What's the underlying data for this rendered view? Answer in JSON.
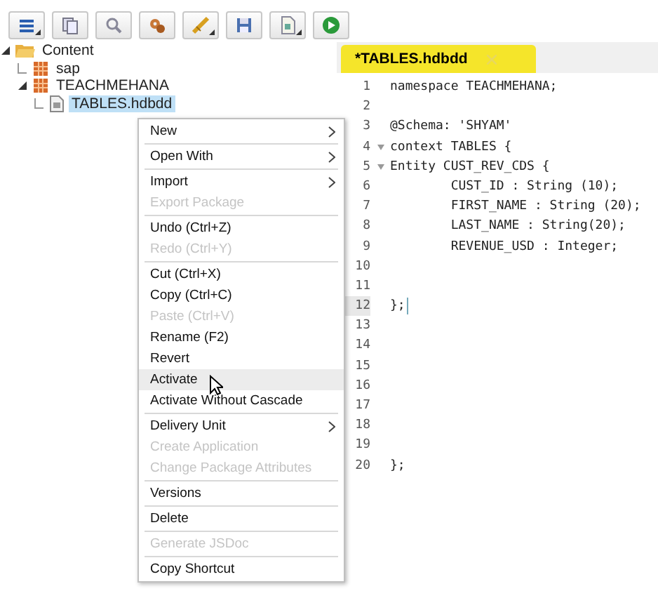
{
  "toolbar": [
    {
      "kind": "menu",
      "dropdown": true
    },
    {
      "kind": "copy",
      "dropdown": false
    },
    {
      "kind": "search",
      "dropdown": false
    },
    {
      "kind": "gears",
      "dropdown": false
    },
    {
      "kind": "wand",
      "dropdown": true
    },
    {
      "kind": "save",
      "dropdown": false
    },
    {
      "kind": "document",
      "dropdown": true
    },
    {
      "kind": "run",
      "dropdown": false
    }
  ],
  "tree": [
    {
      "label": "Content",
      "kind": "folder",
      "expanded": true,
      "selected": false,
      "children": [
        {
          "label": "sap",
          "kind": "package",
          "expanded": false,
          "selected": false
        },
        {
          "label": "TEACHMEHANA",
          "kind": "package",
          "expanded": true,
          "selected": false,
          "children": [
            {
              "label": "TABLES.hdbdd",
              "kind": "file",
              "expanded": false,
              "selected": true
            }
          ]
        }
      ]
    }
  ],
  "editor": {
    "tab": {
      "label": "*TABLES.hdbdd",
      "selected": true
    },
    "lines": [
      {
        "number": "1",
        "text": "namespace TEACHMEHANA;",
        "foldable": false,
        "current": false
      },
      {
        "number": "2",
        "foldable": false,
        "current": false
      },
      {
        "number": "3",
        "text": "@Schema: 'SHYAM'",
        "foldable": false,
        "current": false
      },
      {
        "number": "4",
        "text": "context TABLES {",
        "foldable": true,
        "current": false
      },
      {
        "number": "5",
        "text": "Entity CUST_REV_CDS {",
        "foldable": true,
        "current": false
      },
      {
        "number": "6",
        "text": "        CUST_ID : String (10);",
        "foldable": false,
        "current": false
      },
      {
        "number": "7",
        "text": "        FIRST_NAME : String (20);",
        "foldable": false,
        "current": false
      },
      {
        "number": "8",
        "text": "        LAST_NAME : String(20);",
        "foldable": false,
        "current": false
      },
      {
        "number": "9",
        "text": "        REVENUE_USD : Integer;",
        "foldable": false,
        "current": false
      },
      {
        "number": "10",
        "foldable": false,
        "current": false
      },
      {
        "number": "11",
        "foldable": false,
        "current": false
      },
      {
        "number": "12",
        "text": "};",
        "foldable": false,
        "current": true
      },
      {
        "number": "13",
        "foldable": false,
        "current": false
      },
      {
        "number": "14",
        "foldable": false,
        "current": false
      },
      {
        "number": "15",
        "foldable": false,
        "current": false
      },
      {
        "number": "16",
        "foldable": false,
        "current": false
      },
      {
        "number": "17",
        "foldable": false,
        "current": false
      },
      {
        "number": "18",
        "foldable": false,
        "current": false
      },
      {
        "number": "19",
        "foldable": false,
        "current": false
      },
      {
        "number": "20",
        "text": "};",
        "foldable": false,
        "current": false
      }
    ]
  },
  "context_menu": [
    {
      "kind": "item",
      "label": "New",
      "submenu": true,
      "disabled": false,
      "highlighted": false
    },
    {
      "kind": "separator"
    },
    {
      "kind": "item",
      "label": "Open With",
      "submenu": true,
      "disabled": false,
      "highlighted": false
    },
    {
      "kind": "separator"
    },
    {
      "kind": "item",
      "label": "Import",
      "submenu": true,
      "disabled": false,
      "highlighted": false
    },
    {
      "kind": "item",
      "label": "Export Package",
      "submenu": false,
      "disabled": true,
      "highlighted": false
    },
    {
      "kind": "separator"
    },
    {
      "kind": "item",
      "label": "Undo (Ctrl+Z)",
      "submenu": false,
      "disabled": false,
      "highlighted": false
    },
    {
      "kind": "item",
      "label": "Redo (Ctrl+Y)",
      "submenu": false,
      "disabled": true,
      "highlighted": false
    },
    {
      "kind": "separator"
    },
    {
      "kind": "item",
      "label": "Cut (Ctrl+X)",
      "submenu": false,
      "disabled": false,
      "highlighted": false
    },
    {
      "kind": "item",
      "label": "Copy (Ctrl+C)",
      "submenu": false,
      "disabled": false,
      "highlighted": false
    },
    {
      "kind": "item",
      "label": "Paste (Ctrl+V)",
      "submenu": false,
      "disabled": true,
      "highlighted": false
    },
    {
      "kind": "item",
      "label": "Rename (F2)",
      "submenu": false,
      "disabled": false,
      "highlighted": false
    },
    {
      "kind": "item",
      "label": "Revert",
      "submenu": false,
      "disabled": false,
      "highlighted": false
    },
    {
      "kind": "item",
      "label": "Activate",
      "submenu": false,
      "disabled": false,
      "highlighted": true
    },
    {
      "kind": "item",
      "label": "Activate Without Cascade",
      "submenu": false,
      "disabled": false,
      "highlighted": false
    },
    {
      "kind": "separator"
    },
    {
      "kind": "item",
      "label": "Delivery Unit",
      "submenu": true,
      "disabled": false,
      "highlighted": false
    },
    {
      "kind": "item",
      "label": "Create Application",
      "submenu": false,
      "disabled": true,
      "highlighted": false
    },
    {
      "kind": "item",
      "label": "Change Package Attributes",
      "submenu": false,
      "disabled": true,
      "highlighted": false
    },
    {
      "kind": "separator"
    },
    {
      "kind": "item",
      "label": "Versions",
      "submenu": false,
      "disabled": false,
      "highlighted": false
    },
    {
      "kind": "separator"
    },
    {
      "kind": "item",
      "label": "Delete",
      "submenu": false,
      "disabled": false,
      "highlighted": false
    },
    {
      "kind": "separator"
    },
    {
      "kind": "item",
      "label": "Generate JSDoc",
      "submenu": false,
      "disabled": true,
      "highlighted": false
    },
    {
      "kind": "separator"
    },
    {
      "kind": "item",
      "label": "Copy Shortcut",
      "submenu": false,
      "disabled": false,
      "highlighted": false
    }
  ]
}
